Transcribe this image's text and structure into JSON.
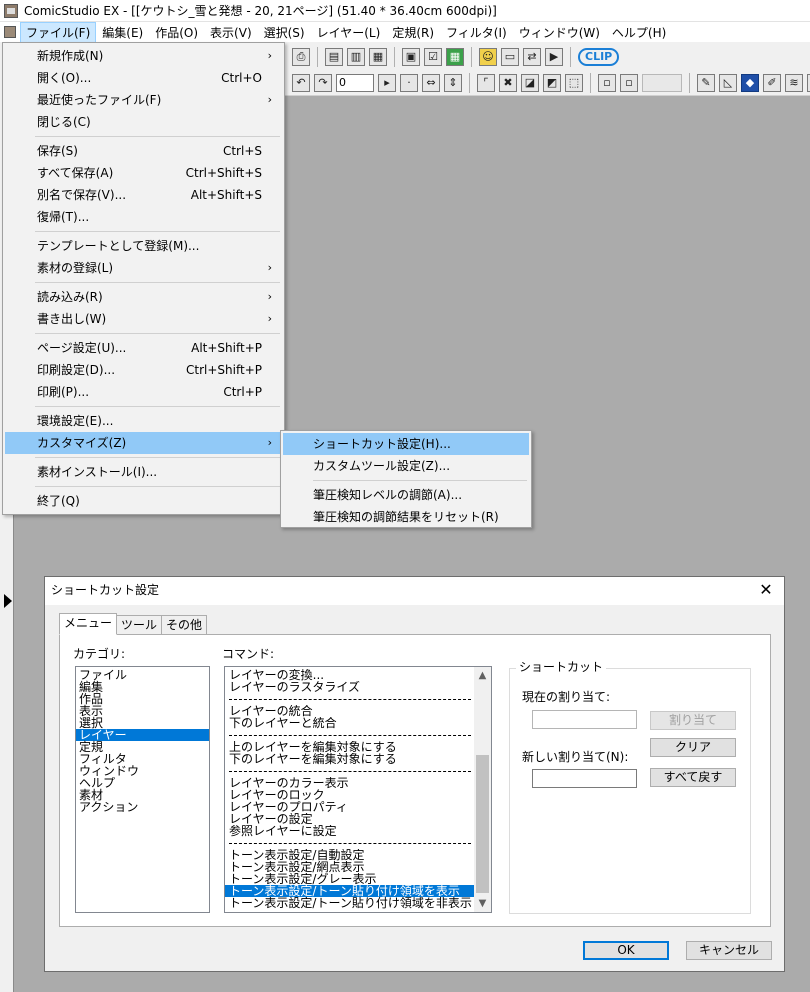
{
  "window": {
    "title": "ComicStudio EX - [[ケウトシ_雪と発想 - 20, 21ページ] (51.40 * 36.40cm 600dpi)]"
  },
  "menubar": {
    "items": [
      "ファイル(F)",
      "編集(E)",
      "作品(O)",
      "表示(V)",
      "選択(S)",
      "レイヤー(L)",
      "定規(R)",
      "フィルタ(I)",
      "ウィンドウ(W)",
      "ヘルプ(H)"
    ]
  },
  "toolbar": {
    "zoom_value": "0",
    "clip_logo": "CLIP"
  },
  "file_menu": {
    "items": [
      {
        "label": "新規作成(N)",
        "shortcut": "",
        "submenu": true
      },
      {
        "label": "開く(O)...",
        "shortcut": "Ctrl+O",
        "submenu": false
      },
      {
        "label": "最近使ったファイル(F)",
        "shortcut": "",
        "submenu": true
      },
      {
        "label": "閉じる(C)",
        "shortcut": "",
        "submenu": false
      },
      {
        "label": "保存(S)",
        "shortcut": "Ctrl+S",
        "submenu": false
      },
      {
        "label": "すべて保存(A)",
        "shortcut": "Ctrl+Shift+S",
        "submenu": false
      },
      {
        "label": "別名で保存(V)...",
        "shortcut": "Alt+Shift+S",
        "submenu": false
      },
      {
        "label": "復帰(T)...",
        "shortcut": "",
        "submenu": false
      },
      {
        "label": "テンプレートとして登録(M)...",
        "shortcut": "",
        "submenu": false
      },
      {
        "label": "素材の登録(L)",
        "shortcut": "",
        "submenu": true
      },
      {
        "label": "読み込み(R)",
        "shortcut": "",
        "submenu": true
      },
      {
        "label": "書き出し(W)",
        "shortcut": "",
        "submenu": true
      },
      {
        "label": "ページ設定(U)...",
        "shortcut": "Alt+Shift+P",
        "submenu": false
      },
      {
        "label": "印刷設定(D)...",
        "shortcut": "Ctrl+Shift+P",
        "submenu": false
      },
      {
        "label": "印刷(P)...",
        "shortcut": "Ctrl+P",
        "submenu": false
      },
      {
        "label": "環境設定(E)...",
        "shortcut": "",
        "submenu": false
      },
      {
        "label": "カスタマイズ(Z)",
        "shortcut": "",
        "submenu": true
      },
      {
        "label": "素材インストール(I)...",
        "shortcut": "",
        "submenu": false
      },
      {
        "label": "終了(Q)",
        "shortcut": "",
        "submenu": false
      }
    ]
  },
  "customize_submenu": {
    "items": [
      "ショートカット設定(H)...",
      "カスタムツール設定(Z)...",
      "筆圧検知レベルの調節(A)...",
      "筆圧検知の調節結果をリセット(R)"
    ]
  },
  "dialog": {
    "title": "ショートカット設定",
    "tabs": [
      "メニュー",
      "ツール",
      "その他"
    ],
    "category_label": "カテゴリ:",
    "categories": [
      "ファイル",
      "編集",
      "作品",
      "表示",
      "選択",
      "レイヤー",
      "定規",
      "フィルタ",
      "ウィンドウ",
      "ヘルプ",
      "素材",
      "アクション"
    ],
    "selected_category": "レイヤー",
    "command_label": "コマンド:",
    "commands": [
      "レイヤーの変換...",
      "レイヤーのラスタライズ",
      "---",
      "レイヤーの統合",
      "下のレイヤーと統合",
      "---",
      "上のレイヤーを編集対象にする",
      "下のレイヤーを編集対象にする",
      "---",
      "レイヤーのカラー表示",
      "レイヤーのロック",
      "レイヤーのプロパティ",
      "レイヤーの設定",
      "参照レイヤーに設定",
      "---",
      "トーン表示設定/自動設定",
      "トーン表示設定/網点表示",
      "トーン表示設定/グレー表示",
      "トーン表示設定/トーン貼り付け領域を表示",
      "トーン表示設定/トーン貼り付け領域を非表示"
    ],
    "selected_command": "トーン表示設定/トーン貼り付け領域を表示",
    "shortcut_group": "ショートカット",
    "current_label": "現在の割り当て:",
    "current_value": "",
    "assign_button": "割り当て",
    "new_label": "新しい割り当て(N):",
    "new_value": "",
    "clear_button": "クリア",
    "reset_all_button": "すべて戻す",
    "ok_button": "OK",
    "cancel_button": "キャンセル",
    "close_glyph": "✕"
  }
}
